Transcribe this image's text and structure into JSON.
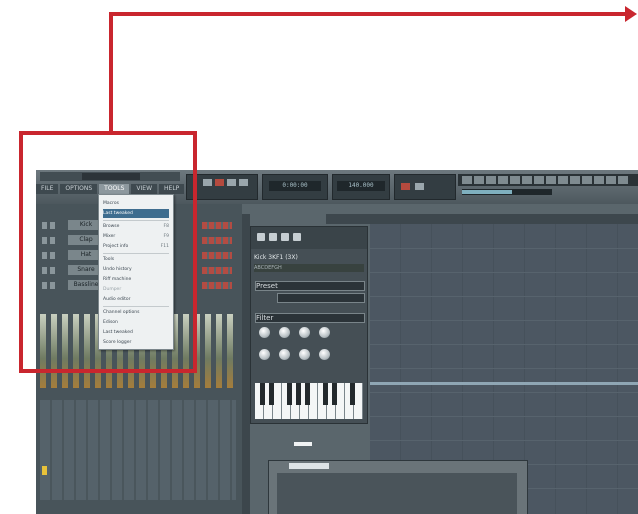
{
  "app": {
    "menubar": [
      "FILE",
      "OPTIONS",
      "TOOLS",
      "VIEW",
      "HELP"
    ],
    "active_menu_index": 2,
    "lcd_time": "0:00:00",
    "lcd_tempo": "140.000",
    "tempo_level": 0.55
  },
  "rack": {
    "channels": [
      "Kick",
      "Clap",
      "Hat",
      "Snare",
      "Bassline"
    ]
  },
  "menu": {
    "items": [
      {
        "label": "Macros",
        "shortcut": ""
      },
      {
        "label": "Last tweaked",
        "shortcut": ""
      },
      {
        "label": "Browse",
        "shortcut": "F8"
      },
      {
        "label": "Mixer",
        "shortcut": "F9"
      },
      {
        "label": "Project info",
        "shortcut": "F11"
      },
      {
        "label": "Tools",
        "shortcut": ""
      },
      {
        "label": "Undo history",
        "shortcut": ""
      },
      {
        "label": "Riff machine",
        "shortcut": ""
      },
      {
        "label": "Dumper",
        "shortcut": ""
      },
      {
        "label": "Audio editor",
        "shortcut": ""
      },
      {
        "label": "Channel options",
        "shortcut": ""
      },
      {
        "label": "Edison",
        "shortcut": ""
      },
      {
        "label": "Last tweaked",
        "shortcut": ""
      },
      {
        "label": "Score logger",
        "shortcut": ""
      }
    ],
    "highlight_index": 1,
    "dim_index": 8
  },
  "plugin": {
    "title": "Kick 3KF1 (3X)",
    "subtitle": "ABCDEFGH",
    "preset_label": "Preset",
    "section_label": "Filter"
  },
  "colors": {
    "annotation": "#c9262e",
    "app_bg": "#5a666c",
    "menu_highlight": "#3e6d8f"
  }
}
